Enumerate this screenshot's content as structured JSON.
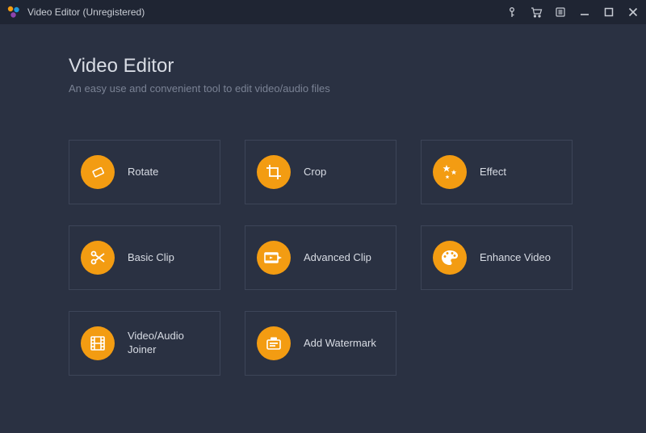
{
  "titlebar": {
    "title": "Video Editor (Unregistered)"
  },
  "header": {
    "heading": "Video Editor",
    "subtitle": "An easy use and convenient tool to edit video/audio files"
  },
  "tiles": [
    {
      "label": "Rotate"
    },
    {
      "label": "Crop"
    },
    {
      "label": "Effect"
    },
    {
      "label": "Basic Clip"
    },
    {
      "label": "Advanced Clip"
    },
    {
      "label": "Enhance Video"
    },
    {
      "label": "Video/Audio Joiner"
    },
    {
      "label": "Add Watermark"
    }
  ],
  "colors": {
    "background": "#2a3142",
    "titlebar": "#1f2533",
    "accent": "#f39c12",
    "border": "#3d4558"
  }
}
